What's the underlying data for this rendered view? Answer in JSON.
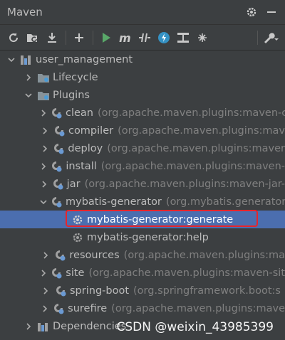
{
  "panel": {
    "title": "Maven"
  },
  "titlebar_icons": [
    "gear-icon",
    "minimize-icon"
  ],
  "toolbar": {
    "buttons": [
      {
        "name": "reload-icon"
      },
      {
        "name": "generate-sources-icon"
      },
      {
        "name": "download-icon"
      },
      {
        "name": "add-icon"
      },
      {
        "name": "run-icon"
      },
      {
        "name": "execute-goal-icon"
      },
      {
        "name": "toggle-offline-icon"
      },
      {
        "name": "skip-tests-icon"
      },
      {
        "name": "show-dependencies-icon"
      },
      {
        "name": "collapse-all-icon"
      },
      {
        "name": "settings-wrench-icon"
      }
    ]
  },
  "tree": {
    "project": "user_management",
    "lifecycle": "Lifecycle",
    "plugins": "Plugins",
    "plugin_items": [
      {
        "name": "clean",
        "desc": "(org.apache.maven.plugins:maven-c"
      },
      {
        "name": "compiler",
        "desc": "(org.apache.maven.plugins:mav"
      },
      {
        "name": "deploy",
        "desc": "(org.apache.maven.plugins:maver"
      },
      {
        "name": "install",
        "desc": "(org.apache.maven.plugins:maven-"
      },
      {
        "name": "jar",
        "desc": "(org.apache.maven.plugins:maven-jar-"
      },
      {
        "name": "mybatis-generator",
        "desc": "(org.mybatis.generator"
      }
    ],
    "goals": [
      "mybatis-generator:generate",
      "mybatis-generator:help"
    ],
    "more_plugins": [
      {
        "name": "resources",
        "desc": "(org.apache.maven.plugins:ma"
      },
      {
        "name": "site",
        "desc": "(org.apache.maven.plugins:maven-sit"
      },
      {
        "name": "spring-boot",
        "desc": "(org.springframework.boot:s"
      },
      {
        "name": "surefire",
        "desc": "(org.apache.maven.plugins:mave"
      }
    ],
    "dependencies": "Dependencies"
  },
  "watermark": "CSDN @weixin_43985399",
  "colors": {
    "background": "#3c3f41",
    "selection": "#4b6eaf",
    "highlight_box": "#e8242a"
  }
}
